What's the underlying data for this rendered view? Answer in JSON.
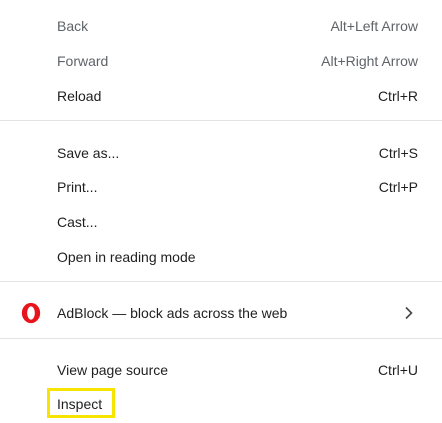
{
  "context_menu": {
    "items": [
      {
        "label": "Back",
        "shortcut": "Alt+Left Arrow",
        "disabled": true
      },
      {
        "label": "Forward",
        "shortcut": "Alt+Right Arrow",
        "disabled": true
      },
      {
        "label": "Reload",
        "shortcut": "Ctrl+R",
        "disabled": false
      },
      {
        "label": "Save as...",
        "shortcut": "Ctrl+S",
        "disabled": false
      },
      {
        "label": "Print...",
        "shortcut": "Ctrl+P",
        "disabled": false
      },
      {
        "label": "Cast...",
        "shortcut": "",
        "disabled": false
      },
      {
        "label": "Open in reading mode",
        "shortcut": "",
        "disabled": false
      },
      {
        "label": "AdBlock — block ads across the web",
        "shortcut": "",
        "icon": "opera-adblock-icon",
        "submenu": true
      },
      {
        "label": "View page source",
        "shortcut": "Ctrl+U",
        "disabled": false
      },
      {
        "label": "Inspect",
        "shortcut": "",
        "disabled": false,
        "highlighted": true
      }
    ]
  },
  "colors": {
    "text": "#1f1f1f",
    "disabled_text": "#5f6368",
    "divider": "#e3e3e3",
    "highlight_border": "#f7e400",
    "opera_red": "#e8141c"
  }
}
